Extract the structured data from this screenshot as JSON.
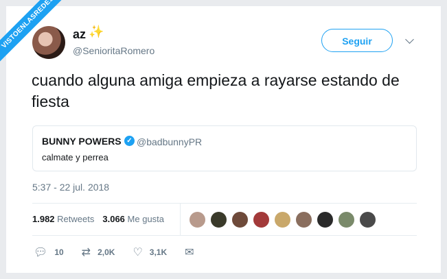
{
  "watermark": "VISTOENLASREDES",
  "tweet": {
    "display_name": "az",
    "handle": "@SenioritaRomero",
    "follow_label": "Seguir",
    "text": "cuando alguna amiga empieza a rayarse estando de fiesta",
    "quote": {
      "name": "BUNNY POWERS",
      "handle": "@badbunnyPR",
      "text": "calmate y perrea"
    },
    "timestamp": "5:37 - 22 jul. 2018",
    "retweets_count": "1.982",
    "retweets_label": "Retweets",
    "likes_count": "3.066",
    "likes_label": "Me gusta",
    "actions": {
      "reply_count": "10",
      "retweet_count": "2,0K",
      "like_count": "3,1K"
    }
  },
  "colors": {
    "accent": "#1da1f2",
    "muted": "#657786",
    "text": "#14171a"
  },
  "liker_avatars": [
    "#b89a8c",
    "#3a3a2a",
    "#6e4a3a",
    "#a33a3a",
    "#c9a86a",
    "#8a6e5e",
    "#2a2a2a",
    "#7a8a6a",
    "#4a4a4a"
  ]
}
